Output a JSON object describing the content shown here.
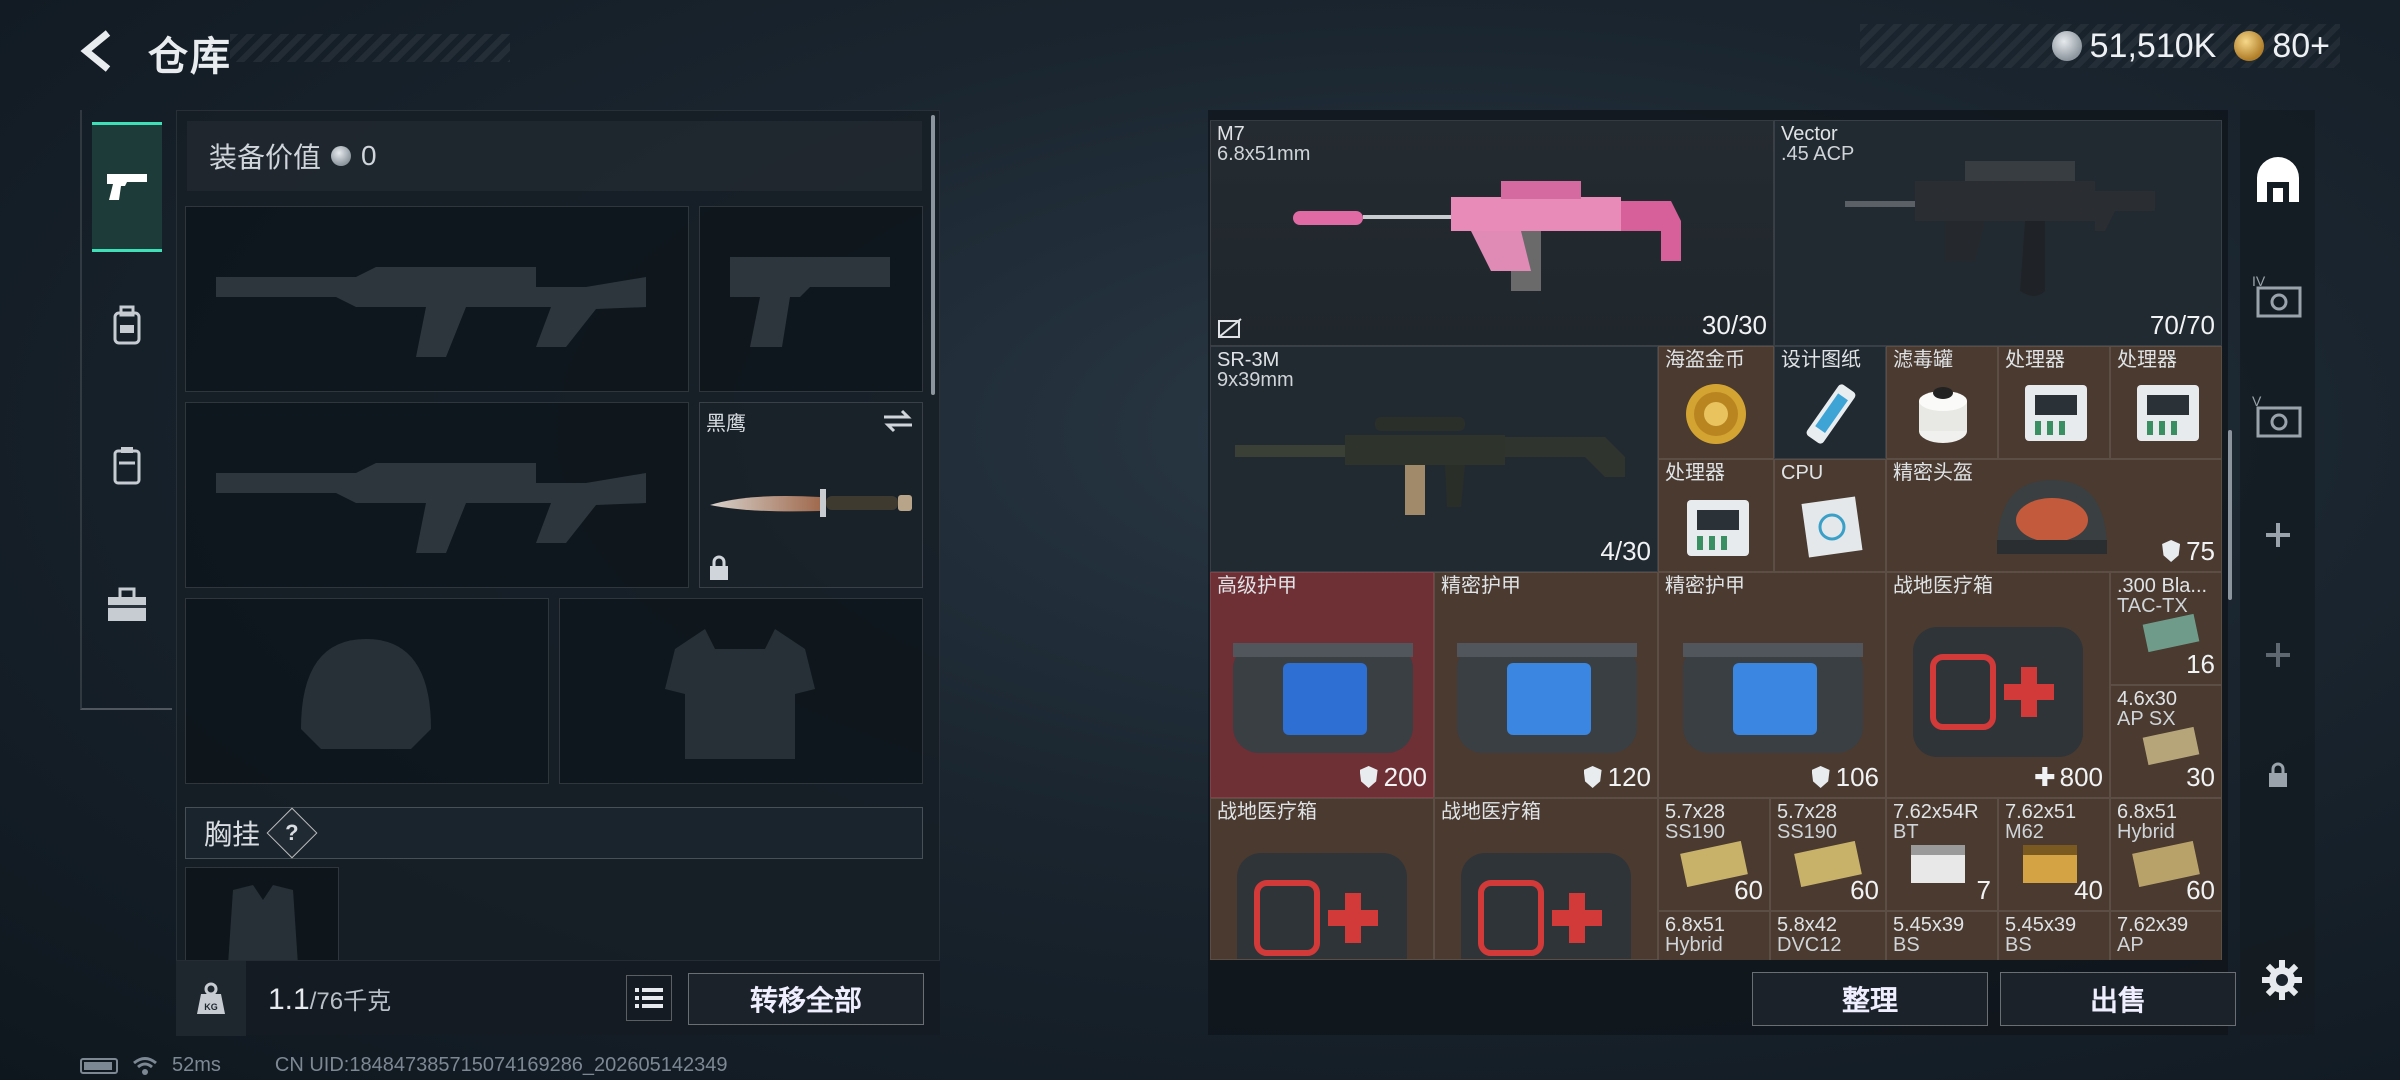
{
  "header": {
    "title": "仓库",
    "currencies": [
      {
        "icon": "silver-coin-icon",
        "value": "51,510K",
        "color": "#a9b1b8"
      },
      {
        "icon": "gold-coin-icon",
        "value": "80+",
        "color": "#d4a64a"
      }
    ]
  },
  "left_tabs": [
    {
      "name": "weapons",
      "icon": "pistol-icon",
      "active": true
    },
    {
      "name": "backpack",
      "icon": "backpack-icon",
      "active": false
    },
    {
      "name": "container",
      "icon": "case-icon",
      "active": false
    },
    {
      "name": "toolbox",
      "icon": "briefcase-icon",
      "active": false
    }
  ],
  "equipment": {
    "value_label": "装备价值",
    "value": "0",
    "knife_slot_label": "黑鹰",
    "chest_label": "胸挂",
    "chest_help": "?"
  },
  "weight": {
    "current": "1.1",
    "max": "/76千克",
    "transfer_all": "转移全部"
  },
  "status_bar": {
    "ping": "52ms",
    "uid": "CN UID:184847385715074169286_202605142349"
  },
  "inventory": {
    "cells": [
      {
        "name": "M7",
        "sub": "6.8x51mm",
        "count": "30/30",
        "type": "dark"
      },
      {
        "name": "Vector",
        "sub": ".45 ACP",
        "count": "70/70",
        "type": "dark"
      },
      {
        "name": "SR-3M",
        "sub": "9x39mm",
        "count": "4/30",
        "type": "dark"
      },
      {
        "name": "海盗金币",
        "count": "",
        "type": "brown"
      },
      {
        "name": "设计图纸",
        "count": "",
        "type": "dark"
      },
      {
        "name": "滤毒罐",
        "count": "",
        "type": "brown"
      },
      {
        "name": "处理器",
        "count": "",
        "type": "brown"
      },
      {
        "name": "处理器",
        "count": "",
        "type": "brown"
      },
      {
        "name": "处理器",
        "count": "",
        "type": "brown"
      },
      {
        "name": "CPU",
        "count": "",
        "type": "brown"
      },
      {
        "name": "精密头盔",
        "count": "75",
        "type": "brown",
        "shield": true
      },
      {
        "name": "高级护甲",
        "count": "200",
        "type": "red",
        "shield": true
      },
      {
        "name": "精密护甲",
        "count": "120",
        "type": "brown",
        "shield": true
      },
      {
        "name": "精密护甲",
        "count": "106",
        "type": "brown",
        "shield": true
      },
      {
        "name": "战地医疗箱",
        "count": "800",
        "type": "brown",
        "plus": true
      },
      {
        "name": ".300 Bla...",
        "sub": "TAC-TX",
        "count": "16",
        "type": "brown"
      },
      {
        "name": "4.6x30",
        "sub": "AP SX",
        "count": "30",
        "type": "brown"
      },
      {
        "name": "战地医疗箱",
        "count": "",
        "type": "brown"
      },
      {
        "name": "战地医疗箱",
        "count": "",
        "type": "brown"
      },
      {
        "name": "5.7x28",
        "sub": "SS190",
        "count": "60",
        "type": "brown"
      },
      {
        "name": "5.7x28",
        "sub": "SS190",
        "count": "60",
        "type": "brown"
      },
      {
        "name": "7.62x54R",
        "sub": "BT",
        "count": "7",
        "type": "brown"
      },
      {
        "name": "7.62x51",
        "sub": "M62",
        "count": "40",
        "type": "brown"
      },
      {
        "name": "6.8x51",
        "sub": "Hybrid",
        "count": "60",
        "type": "brown"
      },
      {
        "name": "6.8x51",
        "sub": "Hybrid",
        "count": "",
        "type": "brown"
      },
      {
        "name": "5.8x42",
        "sub": "DVC12",
        "count": "",
        "type": "brown"
      },
      {
        "name": "5.45x39",
        "sub": "BS",
        "count": "",
        "type": "brown"
      },
      {
        "name": "5.45x39",
        "sub": "BS",
        "count": "",
        "type": "brown"
      },
      {
        "name": "7.62x39",
        "sub": "AP",
        "count": "",
        "type": "brown"
      }
    ]
  },
  "right_rail": [
    {
      "icon": "home-safe-icon"
    },
    {
      "icon": "safe-iv-icon",
      "label": "IV"
    },
    {
      "icon": "safe-v-icon",
      "label": "V"
    },
    {
      "icon": "plus-icon"
    },
    {
      "icon": "plus-icon"
    },
    {
      "icon": "lock-icon"
    }
  ],
  "actions": {
    "sort": "整理",
    "sell": "出售"
  }
}
